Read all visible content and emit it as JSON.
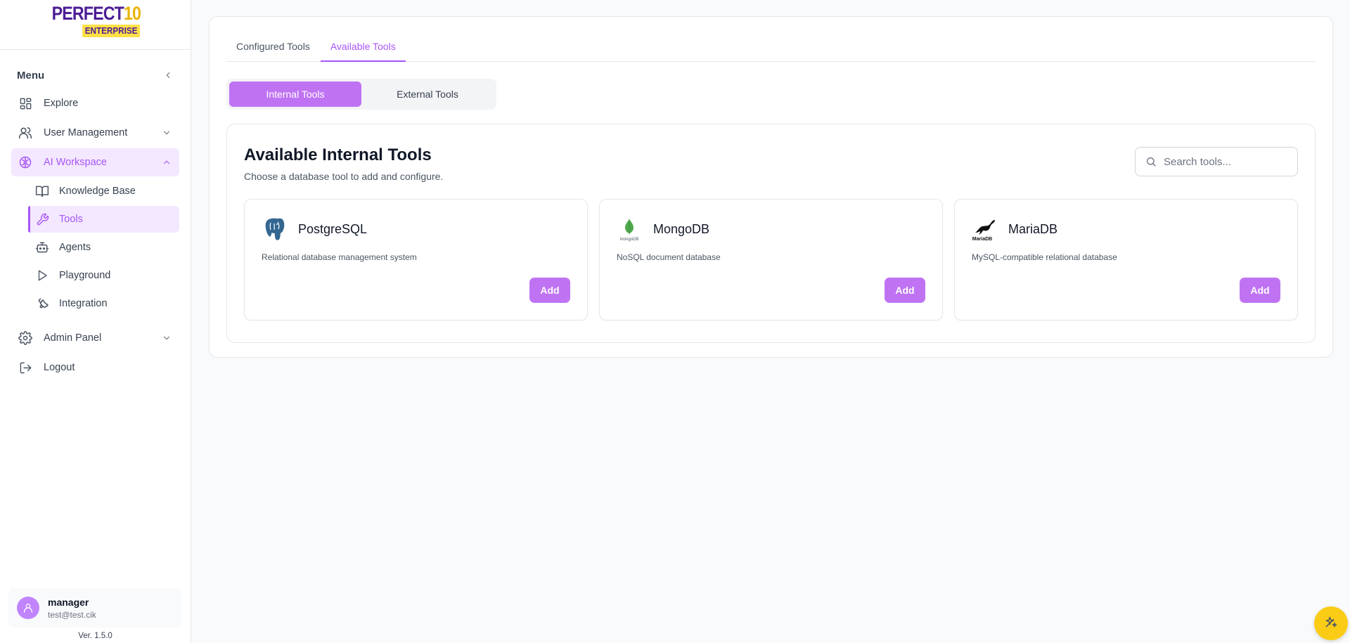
{
  "brand": {
    "logo_main": "PERFECT",
    "logo_num": "10",
    "logo_sub": "ENTERPRISE"
  },
  "sidebar": {
    "menu_title": "Menu",
    "items": [
      {
        "label": "Explore",
        "icon": "grid-icon"
      },
      {
        "label": "User Management",
        "icon": "users-icon"
      },
      {
        "label": "AI Workspace",
        "icon": "brain-icon"
      },
      {
        "label": "Knowledge Base",
        "icon": "book-icon"
      },
      {
        "label": "Tools",
        "icon": "wrench-icon"
      },
      {
        "label": "Agents",
        "icon": "bot-icon"
      },
      {
        "label": "Playground",
        "icon": "play-icon"
      },
      {
        "label": "Integration",
        "icon": "puzzle-icon"
      },
      {
        "label": "Admin Panel",
        "icon": "gear-icon"
      },
      {
        "label": "Logout",
        "icon": "logout-icon"
      }
    ],
    "user": {
      "name": "manager",
      "email": "test@test.cik"
    },
    "version": "Ver. 1.5.0"
  },
  "tabs": [
    {
      "label": "Configured Tools"
    },
    {
      "label": "Available Tools"
    }
  ],
  "segments": [
    {
      "label": "Internal Tools"
    },
    {
      "label": "External Tools"
    }
  ],
  "section": {
    "title": "Available Internal Tools",
    "subtitle": "Choose a database tool to add and configure.",
    "search_placeholder": "Search tools..."
  },
  "tools": [
    {
      "name": "PostgreSQL",
      "description": "Relational database management system",
      "button": "Add",
      "icon": "postgresql-logo"
    },
    {
      "name": "MongoDB",
      "description": "NoSQL document database",
      "button": "Add",
      "icon": "mongodb-logo",
      "logo_text": "mongoDB"
    },
    {
      "name": "MariaDB",
      "description": "MySQL-compatible relational database",
      "button": "Add",
      "icon": "mariadb-logo",
      "logo_text": "MariaDB"
    }
  ],
  "colors": {
    "accent": "#a855f7",
    "accent_light": "#f3e8ff",
    "button": "#bf73f3",
    "fab": "#facc15"
  }
}
